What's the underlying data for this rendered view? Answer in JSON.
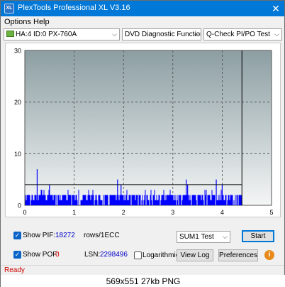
{
  "window": {
    "title": "PlexTools Professional XL V3.16",
    "icon_text": "XL",
    "close_glyph": "✕"
  },
  "menu": {
    "options": "Options",
    "help": "Help"
  },
  "toolbar": {
    "drive": "HA:4 ID:0  PX-760A",
    "function": "DVD Diagnostic Functions",
    "test": "Q-Check PI/PO Test",
    "arrow": "⌵"
  },
  "chart_data": {
    "type": "bar",
    "xlim": [
      0,
      5
    ],
    "ylim": [
      0,
      30
    ],
    "x_ticks": [
      "0",
      "1",
      "2",
      "3",
      "4",
      "5"
    ],
    "y_ticks": [
      "0",
      "10",
      "20",
      "30"
    ],
    "threshold": 4,
    "end_marker_x": 4.4,
    "data_end_x": 4.4,
    "baseline_value": 2,
    "spikes": [
      {
        "x": 0.25,
        "y": 7
      },
      {
        "x": 1.88,
        "y": 5
      },
      {
        "x": 3.27,
        "y": 5
      },
      {
        "x": 3.88,
        "y": 5
      },
      {
        "x": 0.5,
        "y": 4
      },
      {
        "x": 1.95,
        "y": 4
      },
      {
        "x": 3.3,
        "y": 4
      },
      {
        "x": 4.0,
        "y": 4
      }
    ],
    "colors": {
      "bars": "#0000ff",
      "grid": "#4a4a4a",
      "threshold": "#000000",
      "bg_top": "#8c9ea2",
      "bg_bottom": "#f4f6f6"
    }
  },
  "bottom": {
    "show_pif_label": "Show PIF:",
    "pif_value": "18272",
    "pif_unit": "rows/1ECC",
    "show_pof_label": "Show POF:",
    "pof_value": "0",
    "lsn_label": "LSN:",
    "lsn_value": "2298496",
    "logarithmic_label": "Logarithmic",
    "sum_select": "SUM1 Test",
    "start_button": "Start",
    "view_log_button": "View Log",
    "preferences_button": "Preferences",
    "info_glyph": "i",
    "check_glyph": "✓"
  },
  "status": {
    "text": "Ready"
  },
  "caption": {
    "text": "569x551  27kb  PNG"
  }
}
